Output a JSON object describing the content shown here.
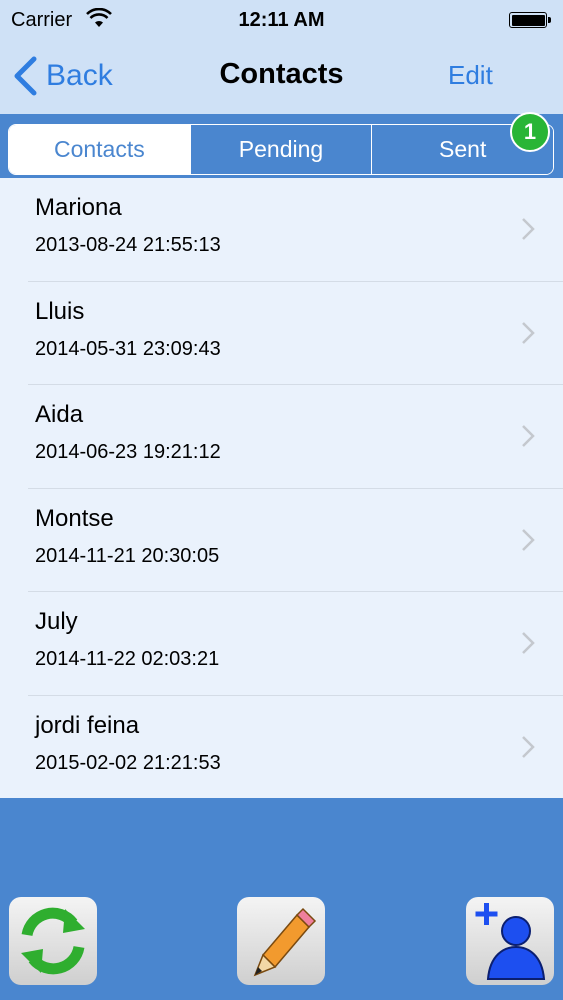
{
  "status_bar": {
    "carrier": "Carrier",
    "time": "12:11 AM"
  },
  "nav": {
    "back_label": "Back",
    "title": "Contacts",
    "edit_label": "Edit"
  },
  "segments": [
    {
      "label": "Contacts",
      "selected": true
    },
    {
      "label": "Pending",
      "selected": false
    },
    {
      "label": "Sent",
      "selected": false
    }
  ],
  "sent_badge": "1",
  "contacts": [
    {
      "name": "Mariona",
      "date": "2013-08-24 21:55:13"
    },
    {
      "name": "Lluis",
      "date": "2014-05-31 23:09:43"
    },
    {
      "name": "Aida",
      "date": "2014-06-23 19:21:12"
    },
    {
      "name": "Montse",
      "date": "2014-11-21 20:30:05"
    },
    {
      "name": "July",
      "date": "2014-11-22 02:03:21"
    },
    {
      "name": "jordi feina",
      "date": "2015-02-02 21:21:53"
    }
  ],
  "toolbar": {
    "refresh_icon": "refresh-icon",
    "compose_icon": "pencil-icon",
    "add_contact_icon": "add-contact-icon"
  },
  "colors": {
    "nav_background": "#cfe1f6",
    "accent": "#2f7de0",
    "toolbar_background": "#4a86cf",
    "list_background": "#eaf2fc",
    "badge": "#29b536"
  }
}
